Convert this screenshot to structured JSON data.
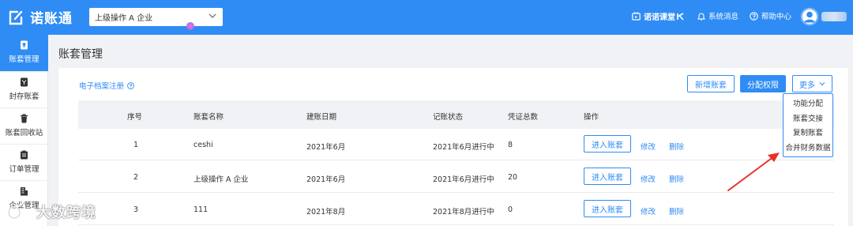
{
  "topbar": {
    "app_name": "诺账通",
    "company_select_value": "上级操作 A 企业",
    "course_label": "诺诺课堂",
    "messages_label": "系统消息",
    "help_label": "帮助中心"
  },
  "sidebar": {
    "items": [
      {
        "label": "账套管理",
        "icon": "ledger-icon",
        "active": true
      },
      {
        "label": "封存账套",
        "icon": "sealed-icon",
        "active": false
      },
      {
        "label": "账套回收站",
        "icon": "trash-icon",
        "active": false
      },
      {
        "label": "订单管理",
        "icon": "order-icon",
        "active": false
      },
      {
        "label": "企业管理",
        "icon": "building-icon",
        "active": false
      }
    ]
  },
  "page": {
    "title": "账套管理",
    "archive_link": "电子档案注册"
  },
  "toolbar": {
    "new_label": "新增账套",
    "permission_label": "分配权限",
    "more_label": "更多"
  },
  "more_menu": [
    "功能分配",
    "账套交接",
    "复制账套",
    "合并财务数据"
  ],
  "table": {
    "headers": [
      "序号",
      "账套名称",
      "建账日期",
      "记账状态",
      "凭证总数",
      "操作"
    ],
    "rows": [
      {
        "no": "1",
        "name": "ceshi",
        "date": "2021年6月",
        "status": "2021年6月进行中",
        "count": "8"
      },
      {
        "no": "2",
        "name": "上级操作 A 企业",
        "date": "2021年6月",
        "status": "2021年6月进行中",
        "count": "20"
      },
      {
        "no": "3",
        "name": "111",
        "date": "2021年8月",
        "status": "2021年8月进行中",
        "count": "0"
      }
    ],
    "actions": {
      "enter": "进入账套",
      "edit": "修改",
      "delete": "删除"
    }
  },
  "watermark": "大数跨境",
  "colors": {
    "primary": "#2f8cf5",
    "annotation": "#e8302a"
  }
}
